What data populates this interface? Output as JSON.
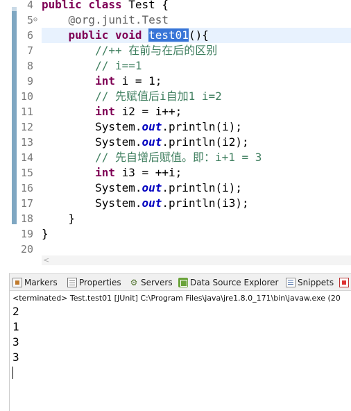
{
  "editor": {
    "lines": [
      {
        "num": "4",
        "tokens": [
          [
            "kw",
            "public"
          ],
          [
            "t",
            " "
          ],
          [
            "kw",
            "class"
          ],
          [
            "t",
            " Test {"
          ]
        ]
      },
      {
        "num": "5",
        "fold": "⊖",
        "tokens": [
          [
            "t",
            "    "
          ],
          [
            "ann",
            "@org.junit."
          ],
          [
            "ann",
            "Test"
          ]
        ]
      },
      {
        "num": "6",
        "current": true,
        "tokens": [
          [
            "t",
            "    "
          ],
          [
            "kw",
            "public"
          ],
          [
            "t",
            " "
          ],
          [
            "kw",
            "void"
          ],
          [
            "t",
            " "
          ],
          [
            "sel",
            "test01"
          ],
          [
            "t",
            "(){"
          ]
        ]
      },
      {
        "num": "7",
        "tokens": [
          [
            "t",
            "        "
          ],
          [
            "cmt",
            "//++ 在前与在后的区别"
          ]
        ]
      },
      {
        "num": "8",
        "tokens": [
          [
            "t",
            "        "
          ],
          [
            "cmt",
            "// i==1"
          ]
        ]
      },
      {
        "num": "9",
        "tokens": [
          [
            "t",
            "        "
          ],
          [
            "kw",
            "int"
          ],
          [
            "t",
            " i = 1;"
          ]
        ]
      },
      {
        "num": "10",
        "tokens": [
          [
            "t",
            "        "
          ],
          [
            "cmt",
            "// 先赋值后i自加1 i=2"
          ]
        ]
      },
      {
        "num": "11",
        "tokens": [
          [
            "t",
            "        "
          ],
          [
            "kw",
            "int"
          ],
          [
            "t",
            " i2 = i++;"
          ]
        ]
      },
      {
        "num": "12",
        "tokens": [
          [
            "t",
            "        System."
          ],
          [
            "fld",
            "out"
          ],
          [
            "t",
            ".println(i);"
          ]
        ]
      },
      {
        "num": "13",
        "tokens": [
          [
            "t",
            "        System."
          ],
          [
            "fld",
            "out"
          ],
          [
            "t",
            ".println(i2);"
          ]
        ]
      },
      {
        "num": "14",
        "tokens": [
          [
            "t",
            "        "
          ],
          [
            "cmt",
            "// 先自增后赋值。即：i+1 = 3"
          ]
        ]
      },
      {
        "num": "15",
        "tokens": [
          [
            "t",
            "        "
          ],
          [
            "kw",
            "int"
          ],
          [
            "t",
            " i3 = ++i;"
          ]
        ]
      },
      {
        "num": "16",
        "tokens": [
          [
            "t",
            "        System."
          ],
          [
            "fld",
            "out"
          ],
          [
            "t",
            ".println(i);"
          ]
        ]
      },
      {
        "num": "17",
        "tokens": [
          [
            "t",
            "        System."
          ],
          [
            "fld",
            "out"
          ],
          [
            "t",
            ".println(i3);"
          ]
        ]
      },
      {
        "num": "18",
        "tokens": [
          [
            "t",
            "    }"
          ]
        ]
      },
      {
        "num": "19",
        "tokens": [
          [
            "t",
            "}"
          ]
        ]
      },
      {
        "num": "20",
        "tokens": []
      }
    ],
    "scroll_left_arrow": "<"
  },
  "console": {
    "tabs": [
      {
        "label": "Markers",
        "icon": "markers-icon"
      },
      {
        "label": "Properties",
        "icon": "properties-icon"
      },
      {
        "label": "Servers",
        "icon": "servers-icon"
      },
      {
        "label": "Data Source Explorer",
        "icon": "data-source-explorer-icon"
      },
      {
        "label": "Snippets",
        "icon": "snippets-icon"
      }
    ],
    "description": "<terminated> Test.test01 [JUnit] C:\\Program Files\\java\\jre1.8.0_171\\bin\\javaw.exe (20",
    "output": [
      "2",
      "1",
      "3",
      "3"
    ]
  }
}
